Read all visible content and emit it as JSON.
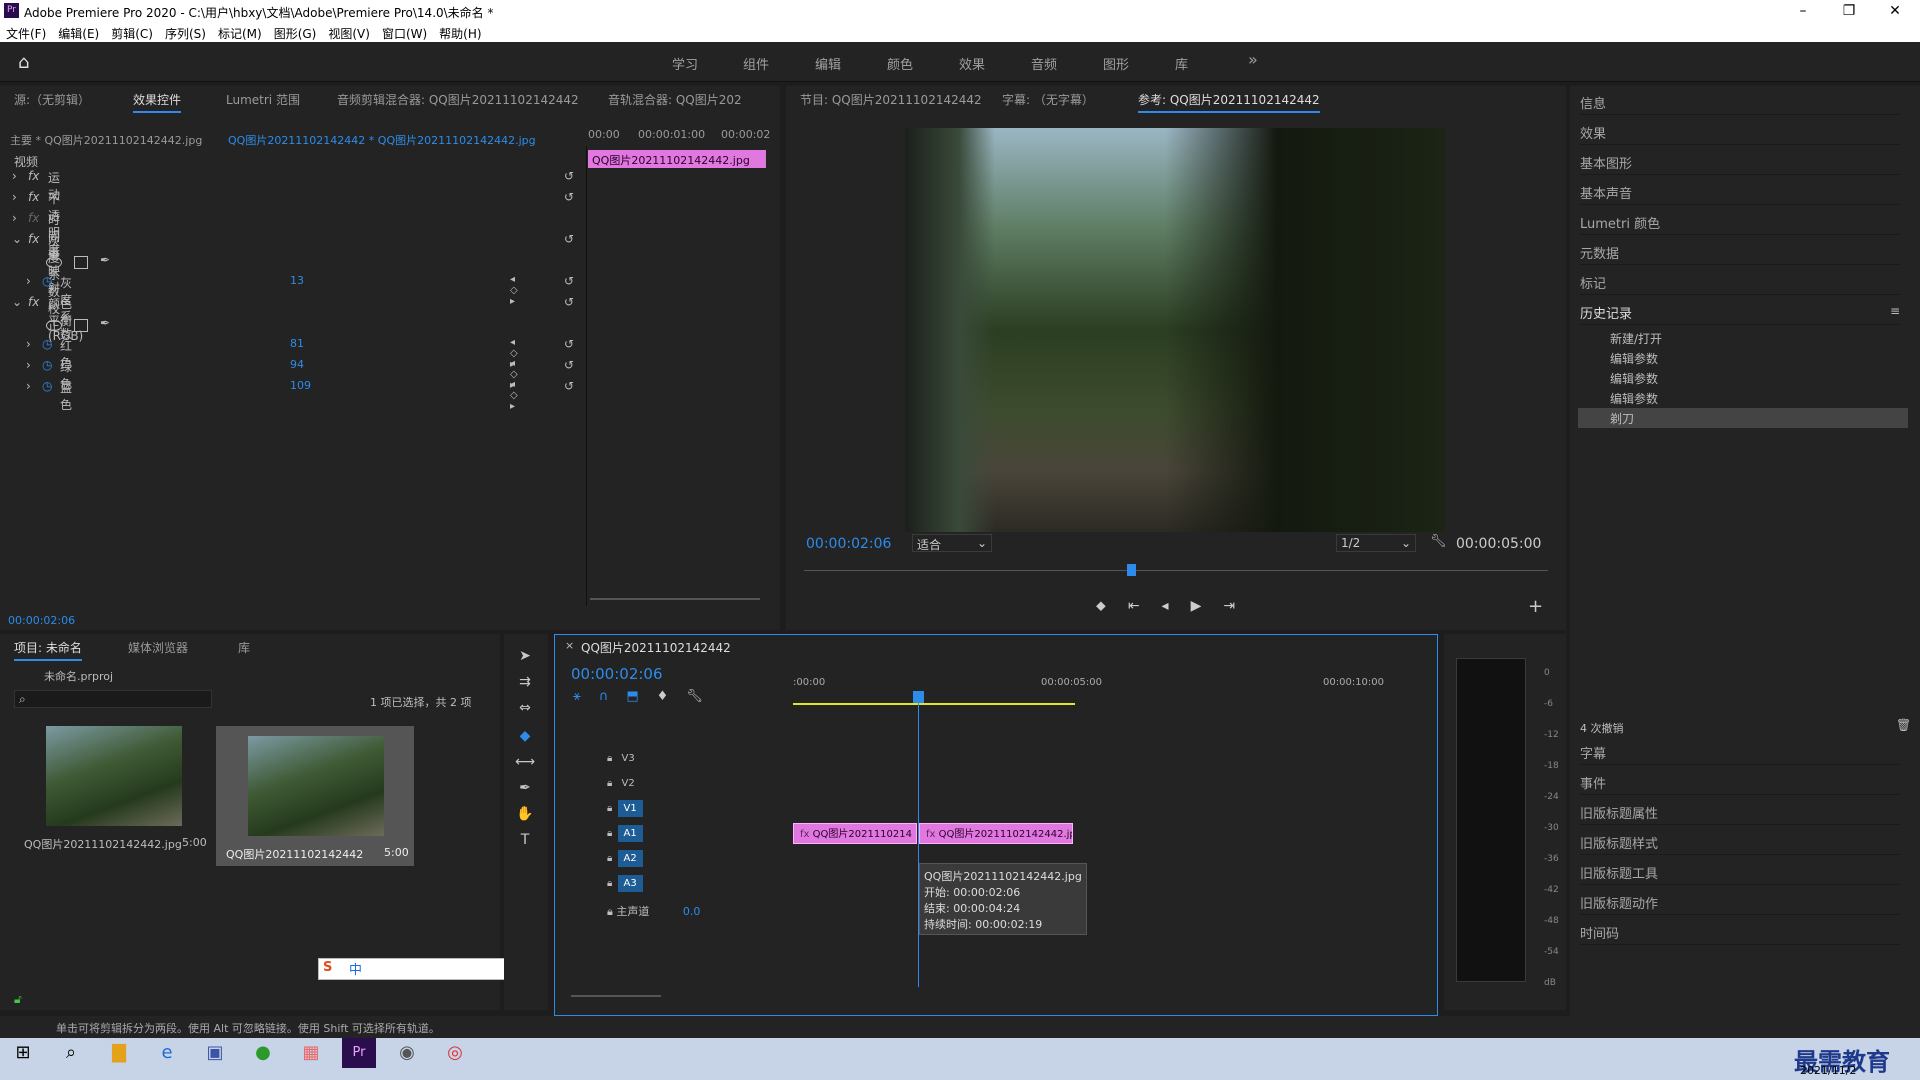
{
  "window": {
    "title": "Adobe Premiere Pro 2020 - C:\\用户\\hbxy\\文档\\Adobe\\Premiere Pro\\14.0\\未命名 *",
    "logo": "Pr"
  },
  "menu": [
    "文件(F)",
    "编辑(E)",
    "剪辑(C)",
    "序列(S)",
    "标记(M)",
    "图形(G)",
    "视图(V)",
    "窗口(W)",
    "帮助(H)"
  ],
  "workspaces": [
    "学习",
    "组件",
    "编辑",
    "颜色",
    "效果",
    "音频",
    "图形",
    "库"
  ],
  "source_panel": {
    "tabs": [
      "源:（无剪辑）",
      "效果控件",
      "Lumetri 范围",
      "音频剪辑混合器: QQ图片20211102142442",
      "音轨混合器: QQ图片202"
    ],
    "master": "主要 * QQ图片20211102142442.jpg",
    "seq": "QQ图片20211102142442 * QQ图片20211102142442.jpg",
    "ruler": [
      "00:00",
      "00:00:01:00",
      "00:00:02"
    ],
    "clip": "QQ图片20211102142442.jpg",
    "section": "视频",
    "effects": [
      {
        "name": "运动"
      },
      {
        "name": "不透明度"
      },
      {
        "name": "时间重映射"
      },
      {
        "name": "灰度系数校正"
      },
      {
        "name": "灰度系数",
        "value": "13"
      },
      {
        "name": "颜色平衡 (RGB)"
      },
      {
        "name": "红色",
        "value": "81"
      },
      {
        "name": "绿色",
        "value": "94"
      },
      {
        "name": "蓝色",
        "value": "109"
      }
    ],
    "timecode": "00:00:02:06"
  },
  "program": {
    "tabs": [
      "节目: QQ图片20211102142442",
      "字幕: （无字幕）",
      "参考: QQ图片20211102142442"
    ],
    "timecode": "00:00:02:06",
    "fit": "适合",
    "res": "1/2",
    "duration": "00:00:05:00"
  },
  "right": {
    "items": [
      "信息",
      "效果",
      "基本图形",
      "基本声音",
      "Lumetri 颜色",
      "元数据",
      "标记"
    ],
    "history_title": "历史记录",
    "history": [
      "新建/打开",
      "编辑参数",
      "编辑参数",
      "编辑参数",
      "剃刀"
    ],
    "undo": "4 次撤销",
    "lower": [
      "字幕",
      "事件",
      "旧版标题属性",
      "旧版标题样式",
      "旧版标题工具",
      "旧版标题动作",
      "时间码"
    ]
  },
  "project": {
    "tabs": [
      "项目: 未命名",
      "媒体浏览器",
      "库"
    ],
    "file": "未命名.prproj",
    "count": "1 项已选择，共 2 项",
    "items": [
      {
        "name": "QQ图片20211102142442.jpg",
        "dur": "5:00"
      },
      {
        "name": "QQ图片20211102142442",
        "dur": "5:00"
      }
    ]
  },
  "timeline": {
    "tab": "QQ图片20211102142442",
    "timecode": "00:00:02:06",
    "ruler": [
      ":00:00",
      "00:00:05:00",
      "00:00:10:00"
    ],
    "tracks": [
      "V3",
      "V2",
      "V1",
      "A1",
      "A2",
      "A3"
    ],
    "master": "主声道",
    "master_val": "0.0",
    "clip1": "QQ图片2021110214",
    "clip2": "QQ图片20211102142442.jp",
    "tooltip": [
      "QQ图片20211102142442.jpg",
      "开始: 00:00:02:06",
      "结束: 00:00:04:24",
      "持续时间: 00:00:02:19"
    ]
  },
  "meter": [
    "0",
    "-6",
    "-12",
    "-18",
    "-24",
    "-30",
    "-36",
    "-42",
    "-48",
    "-54",
    "dB"
  ],
  "status": "单击可将剪辑拆分为两段。使用 Alt 可忽略链接。使用 Shift 可选择所有轨道。",
  "taskbar": {
    "date": "2021/11/2",
    "watermark": "最需教育",
    "ime": "中"
  }
}
